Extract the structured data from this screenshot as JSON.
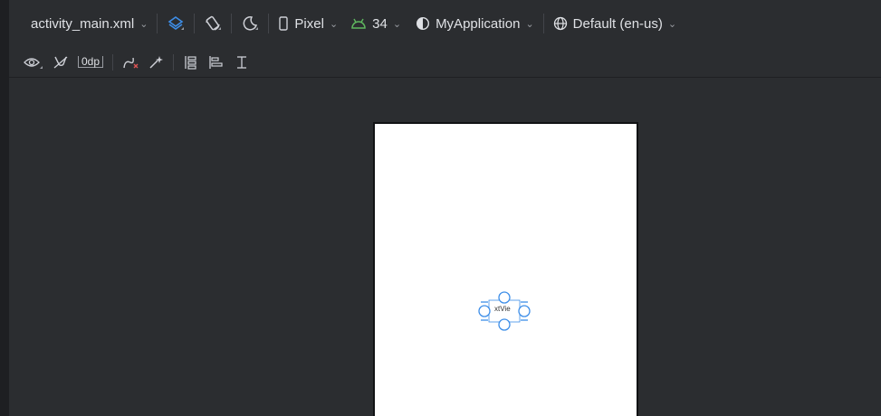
{
  "toolbar": {
    "file_name": "activity_main.xml",
    "device": "Pixel",
    "api_level": "34",
    "theme": "MyApplication",
    "locale": "Default (en-us)"
  },
  "layout_toolbar": {
    "margin_value": "0dp"
  },
  "preview": {
    "textview_label": "xtVie"
  },
  "icons": {
    "design_surface": "layers-icon",
    "orientation": "rotate-icon",
    "night_mode": "moon-icon",
    "device": "phone-icon",
    "api": "android-icon",
    "theme": "half-circle-icon",
    "locale": "globe-icon"
  },
  "colors": {
    "accent": "#3d8ee8",
    "api_green": "#5fb85f",
    "background": "#2b2d30",
    "device_screen": "#ffffff"
  }
}
